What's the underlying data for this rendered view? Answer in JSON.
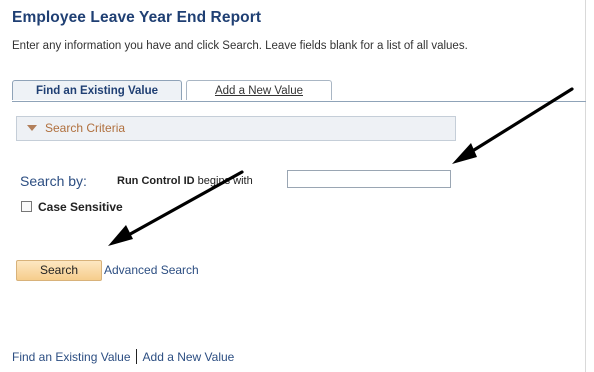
{
  "page": {
    "title": "Employee Leave Year End Report",
    "instructions": "Enter any information you have and click Search. Leave fields blank for a list of all values."
  },
  "tabs": [
    {
      "label": "Find an Existing Value",
      "active": true
    },
    {
      "label": "Add a New Value",
      "active": false
    }
  ],
  "criteria": {
    "label": "Search Criteria",
    "icon": "triangle-down-icon"
  },
  "search": {
    "search_by_label": "Search by:",
    "field_label": "Run Control ID",
    "operator_label": "begins with",
    "input_value": "",
    "case_sensitive_label": "Case Sensitive",
    "case_sensitive_checked": false,
    "search_button": "Search",
    "advanced_link": "Advanced Search"
  },
  "footer": {
    "find_link": "Find an Existing Value",
    "add_link": "Add a New Value"
  },
  "colors": {
    "title": "#1f3f73",
    "link": "#2c4e82",
    "criteria_text": "#b0703e",
    "button_bg": "#f6cd8c"
  }
}
